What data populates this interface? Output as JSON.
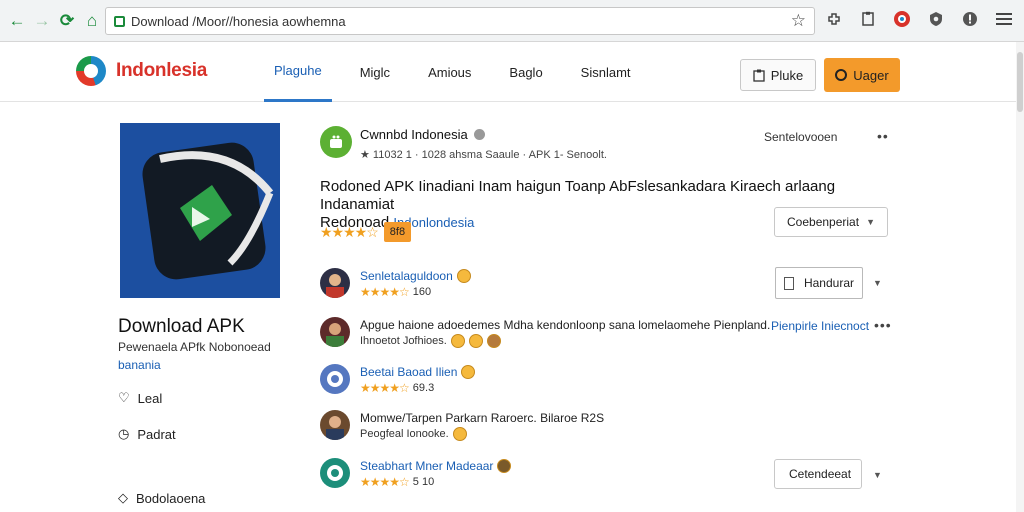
{
  "browser": {
    "url": "Download /Moor//honesia aowhemna",
    "nav": {
      "back": "←",
      "forward": "→",
      "reload": "⟳",
      "home": "⌂"
    },
    "toolbar_icons": [
      "extension-icon",
      "document-icon",
      "profile-icon",
      "shield-icon",
      "alert-icon",
      "menu-icon"
    ],
    "star": "☆"
  },
  "site": {
    "logo_text": "Indonlesia",
    "nav": [
      "Plaguhe",
      "Miglc",
      "Amious",
      "Baglo",
      "Sisnlamt"
    ],
    "btn_outline": "Pluke",
    "btn_orange": "Uager"
  },
  "left": {
    "title": "Download APK",
    "subtitle": "Pewenaela APfk Nobonoead",
    "link": "banania",
    "items": [
      {
        "icon": "♡",
        "label": "Leal"
      },
      {
        "icon": "◷",
        "label": "Padrat"
      },
      {
        "icon": "◇",
        "label": "Bodolaoena"
      }
    ]
  },
  "app": {
    "name": "Cwnnbd Indonesia",
    "meta": "★ 11032 1 · 1028 ahsma Saaule · APK 1- Senoolt.",
    "top_right": "Sentelovooen",
    "desc_line1": "Rodoned APK Iinadiani Inam haigun Toanp AbFslesankadara Kiraech arlaang Indanamiat",
    "desc_line2_plain": "Redonoad",
    "desc_line2_blue": "Indonlondesia",
    "rating_stars": "★★★★☆",
    "rating_badge": "8f8",
    "sort_select": "Coebenperiat"
  },
  "reviews": [
    {
      "title": "Senletalaguldoon",
      "stars": "★★★★☆",
      "count": "160",
      "blue": true
    },
    {
      "title": "Apgue haione adoedemes Mdha kendonloonp sana lomelaomehe Pienpland.",
      "subtitle": "Ihnoetot Jofhioes.",
      "blue": false
    },
    {
      "title": "Beetai Baoad Ilien",
      "stars": "★★★★☆",
      "count": "69.3",
      "blue": true
    },
    {
      "title": "Momwe/Tarpen Parkarn Raroerc. Bilaroe R2S",
      "subtitle": "Peogfeal Ionooke.",
      "blue": false
    },
    {
      "title": "Steabhart Mner Madeaar",
      "stars": "★★★★☆",
      "count": "5 10",
      "blue": true
    }
  ],
  "controls": {
    "review_link": "Pienpirle Iniecnoct",
    "checkbox_label": "Handurar",
    "bottom_select": "Cetendeeat"
  },
  "colors": {
    "accent_blue": "#1a5fb4",
    "orange": "#f39a2b",
    "logo_red": "#d8322a",
    "app_icon_bg": "#1c4fa0",
    "green": "#5cb033"
  }
}
